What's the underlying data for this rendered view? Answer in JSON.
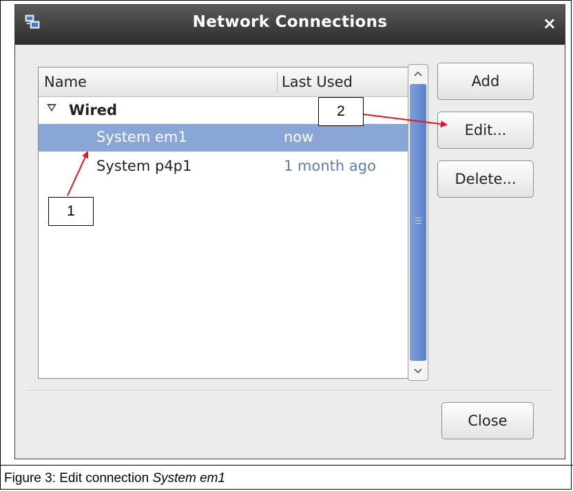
{
  "window": {
    "title": "Network Connections",
    "close_glyph": "×",
    "icon": "network-connections-icon"
  },
  "list": {
    "columns": {
      "name": "Name",
      "last_used": "Last Used"
    },
    "group": {
      "label": "Wired",
      "expanded": true
    },
    "rows": [
      {
        "name": "System em1",
        "last_used": "now",
        "selected": true
      },
      {
        "name": "System p4p1",
        "last_used": "1 month ago",
        "selected": false
      }
    ]
  },
  "buttons": {
    "add": "Add",
    "edit": "Edit...",
    "delete": "Delete...",
    "close": "Close"
  },
  "annotations": {
    "callout_1": "1",
    "callout_2": "2",
    "arrow_color": "#e8141b"
  },
  "caption": {
    "prefix": "Figure 3: Edit connection ",
    "emphasis": "System em1"
  },
  "colors": {
    "selection": "#8aa6d6",
    "titlebar": "#3a3a3a",
    "scroll_thumb": "#6b8fd4"
  }
}
